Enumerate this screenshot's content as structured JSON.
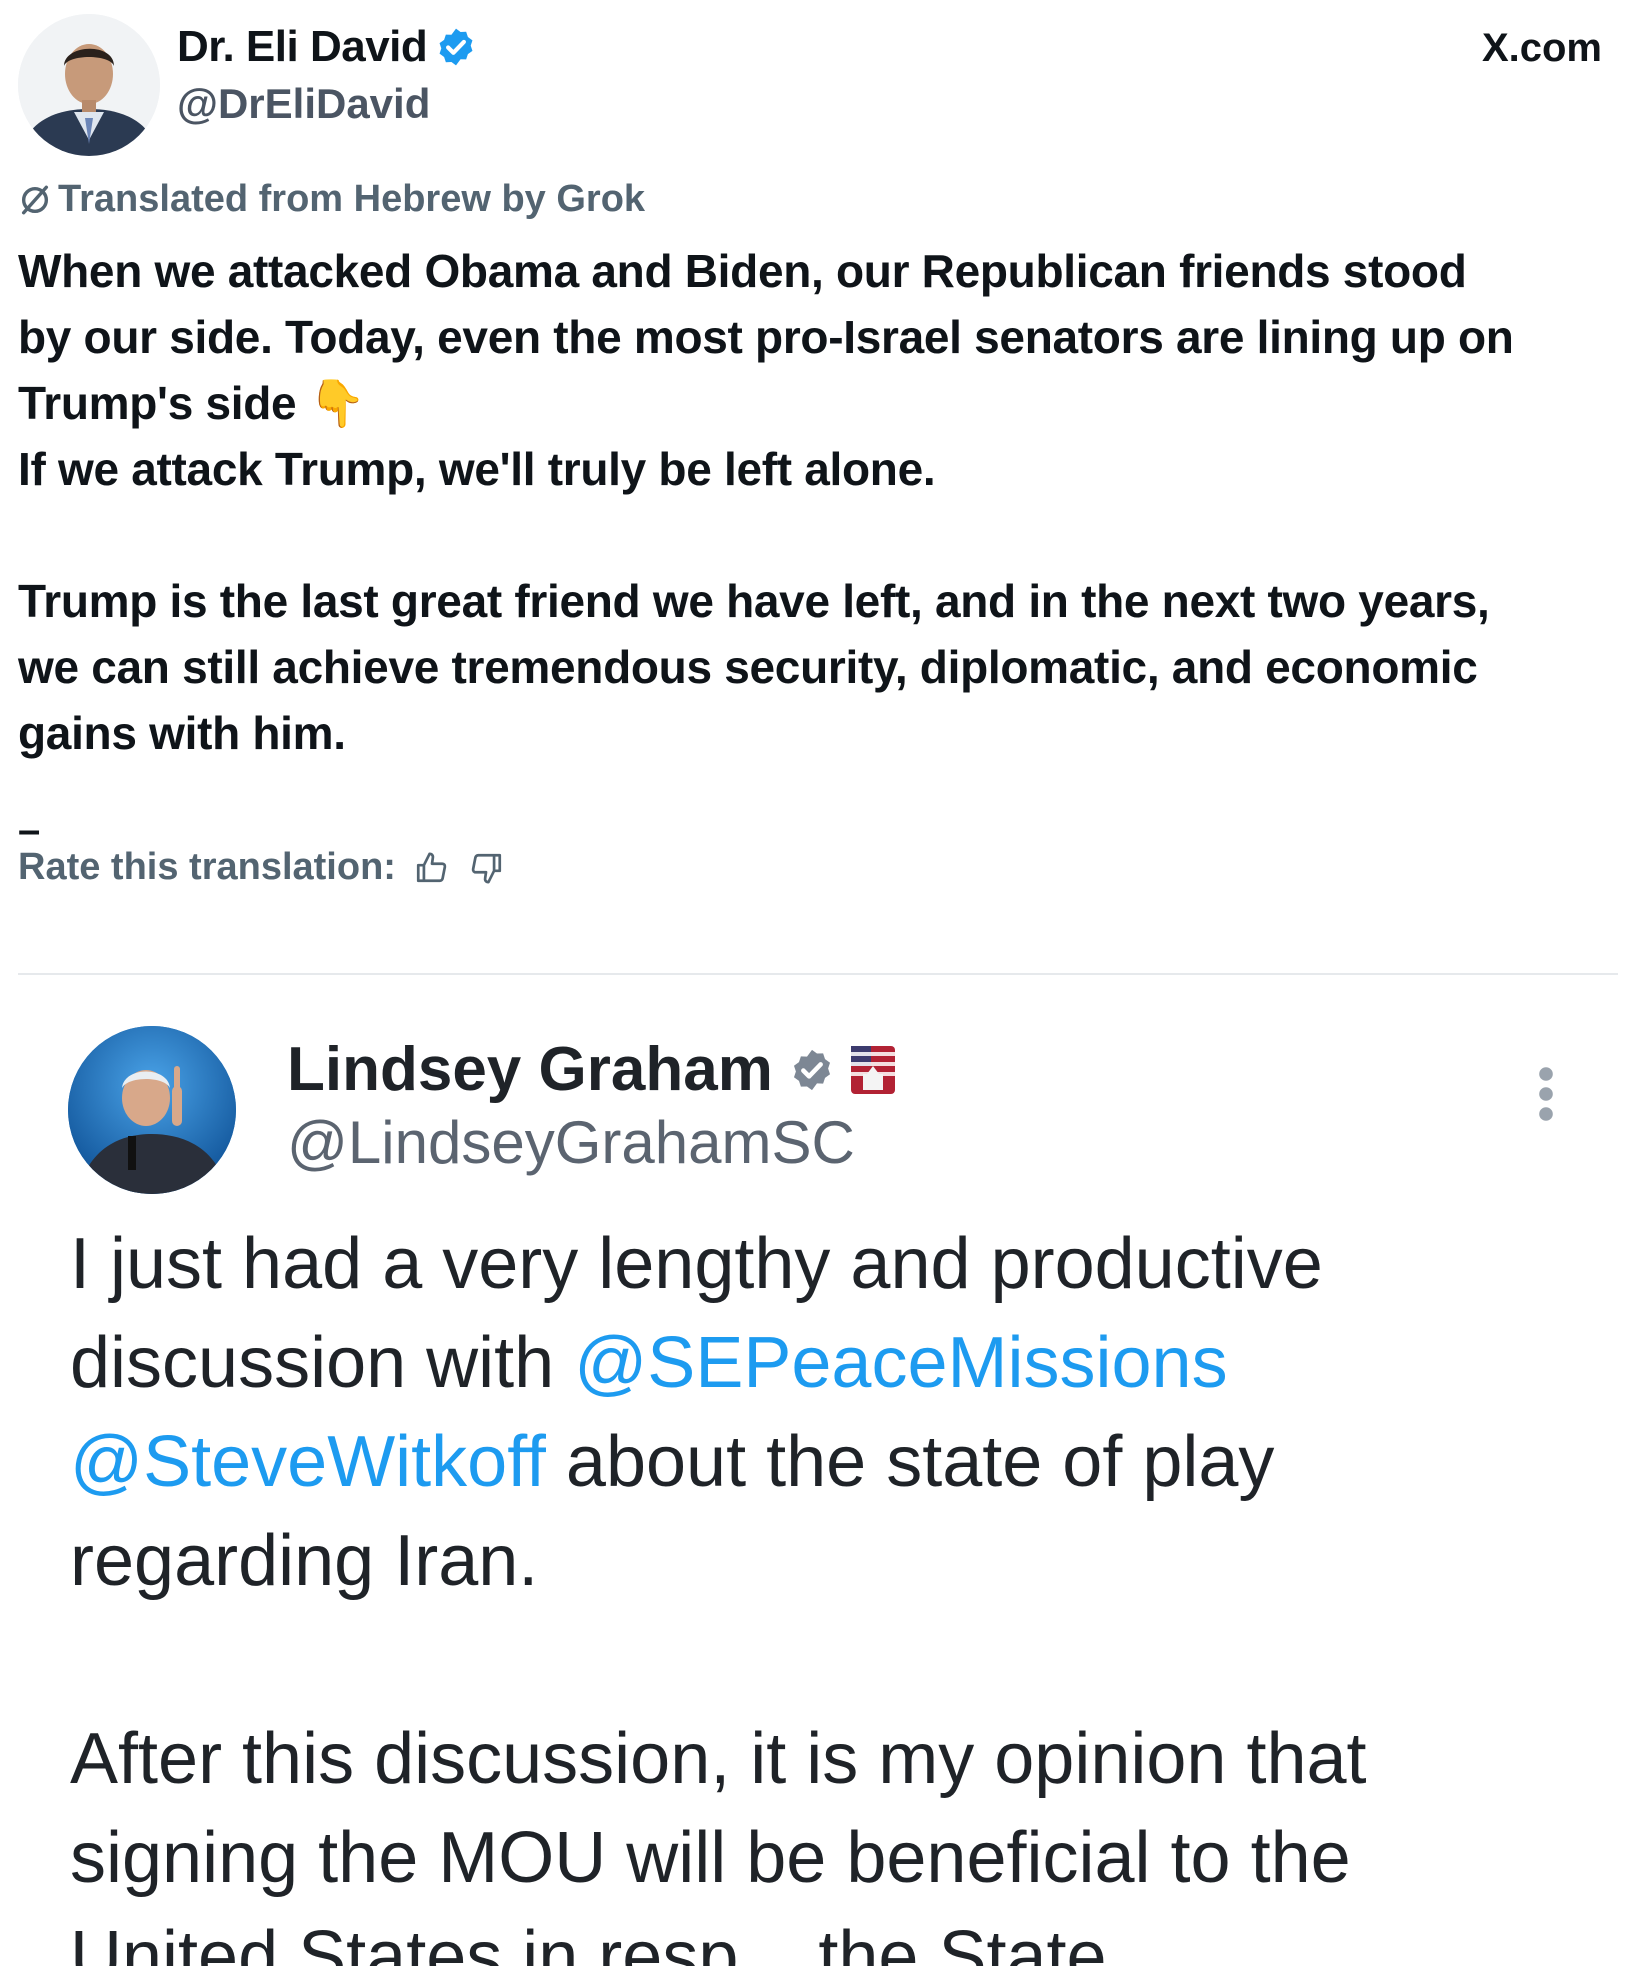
{
  "post": {
    "author_name": "Dr. Eli David",
    "author_handle": "@DrEliDavid",
    "site": "X.com",
    "translation_label": "Translated from Hebrew by Grok",
    "body": {
      "p1_line1": "When we attacked Obama and Biden, our Republican friends stood",
      "p1_line2": "by our side. Today, even the most pro-Israel senators are lining up on",
      "p1_line3": "Trump's side 👇",
      "p1_line4": "If we attack Trump, we'll truly be left alone.",
      "p2_line1": "Trump is the last great friend we have left, and in the next two years,",
      "p2_line2": "we can still achieve tremendous security, diplomatic, and economic",
      "p2_line3": "gains with him."
    },
    "dash": "–",
    "rate_label": "Rate this translation:",
    "icons": {
      "grok": "grok-slash-icon",
      "verified": "verified-badge-icon",
      "thumbs_up": "thumbs-up-icon",
      "thumbs_down": "thumbs-down-icon"
    },
    "colors": {
      "verified": "#1d9bf0",
      "muted": "#536471",
      "text": "#0f1419"
    }
  },
  "embed": {
    "author_name": "Lindsey Graham",
    "author_handle": "@LindseyGrahamSC",
    "line1": "I just had a very lengthy and productive",
    "line2_pre": "discussion with ",
    "mention1": "@SEPeaceMissions",
    "mention2": "@SteveWitkoff",
    "line3_post": " about the state of play",
    "line4": "regarding Iran.",
    "line5": "After this discussion, it is my opinion that",
    "line6": "signing the MOU will be beneficial to the",
    "line7": "United States in resp... the State..."
  }
}
